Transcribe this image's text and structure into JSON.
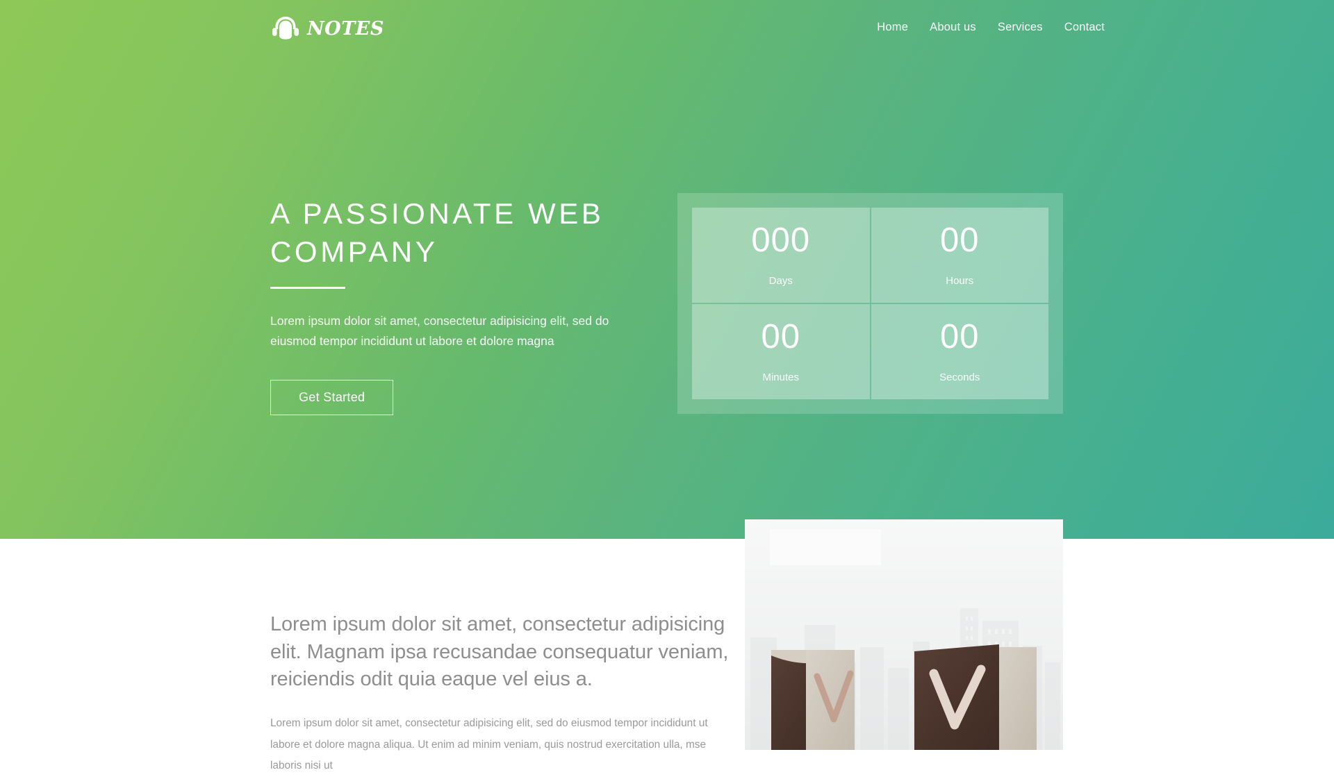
{
  "brand": {
    "name": "NOTES",
    "icon": "headphones-icon"
  },
  "nav": {
    "items": [
      {
        "label": "Home",
        "name": "nav-link-home"
      },
      {
        "label": "About us",
        "name": "nav-link-about-us"
      },
      {
        "label": "Services",
        "name": "nav-link-services"
      },
      {
        "label": "Contact",
        "name": "nav-link-contact"
      }
    ]
  },
  "hero": {
    "title": "A PASSIONATE WEB\nCOMPANY",
    "subtitle": "Lorem ipsum dolor sit amet, consectetur adipisicing elit, sed do eiusmod tempor incididunt ut labore et dolore magna",
    "cta_label": "Get Started"
  },
  "countdown": {
    "units": [
      {
        "value": "000",
        "label": "Days",
        "name": "countdown-days"
      },
      {
        "value": "00",
        "label": "Hours",
        "name": "countdown-hours"
      },
      {
        "value": "00",
        "label": "Minutes",
        "name": "countdown-minutes"
      },
      {
        "value": "00",
        "label": "Seconds",
        "name": "countdown-seconds"
      }
    ]
  },
  "about": {
    "lead": "Lorem ipsum dolor sit amet, consectetur adipisicing elit. Magnam ipsa recusandae consequatur veniam, reiciendis odit quia eaque vel eius a.",
    "body": "Lorem ipsum dolor sit amet, consectetur adipisicing elit, sed do eiusmod tempor incididunt ut labore et dolore magna aliqua. Ut enim ad minim veniam, quis nostrud exercitation ulla, mse laboris nisi ut",
    "image_alt": "wooden-blocks-checkmarks-cityscape"
  },
  "colors": {
    "gradient_start": "#8ec957",
    "gradient_mid": "#63b86e",
    "gradient_end": "#3bab9b",
    "text_on_hero": "#ffffff",
    "about_text": "#8e8e8e"
  }
}
